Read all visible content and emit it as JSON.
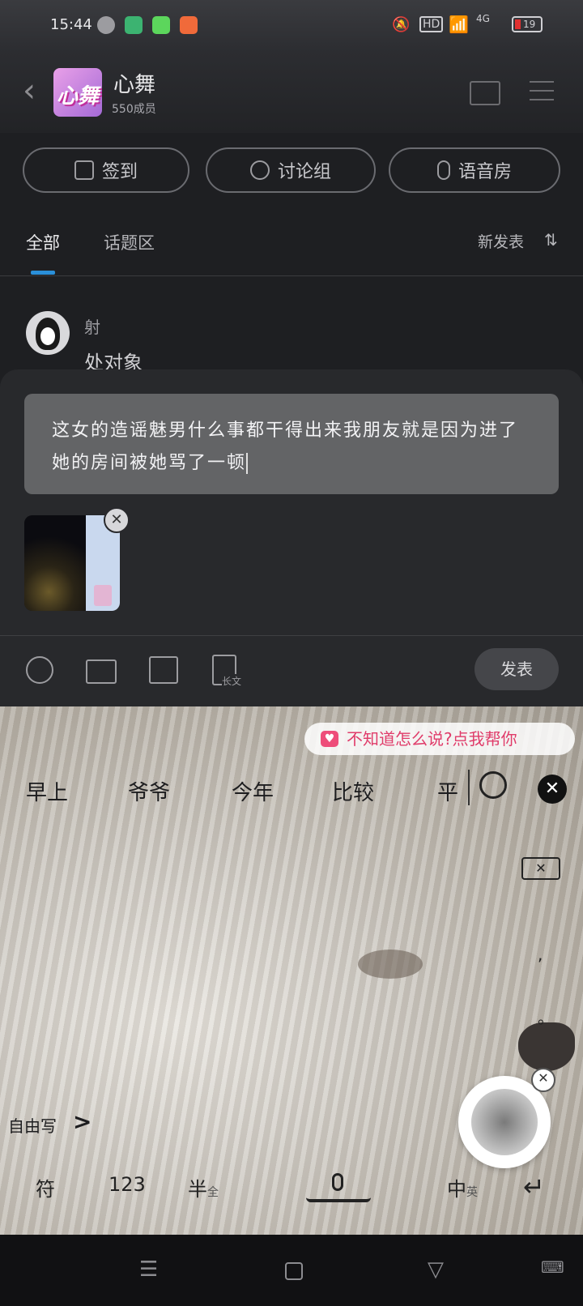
{
  "status_bar": {
    "time": "15:44",
    "hd_label": "HD",
    "network": "4G",
    "battery": "19"
  },
  "header": {
    "group_name": "心舞",
    "member_count": "550成员",
    "avatar_text": "心舞"
  },
  "actions": {
    "checkin": "签到",
    "discussion": "讨论组",
    "voice_room": "语音房"
  },
  "tabs": {
    "all": "全部",
    "topics": "话题区",
    "sort": "新发表"
  },
  "post": {
    "author": "射",
    "content": "处对象"
  },
  "compose": {
    "text": "这女的造谣魅男什么事都干得出来我朋友就是因为进了她的房间被她骂了一顿",
    "longtext_label": "长文",
    "publish": "发表"
  },
  "keyboard": {
    "suggest_bubble": "不知道怎么说?点我帮你",
    "candidates": [
      "早上",
      "爷爷",
      "今年",
      "比较",
      "平"
    ],
    "freewrite": "自由写",
    "comma": ",",
    "period": "。",
    "symbols": "符",
    "numbers": "123",
    "half": "半",
    "half_sub": "全",
    "lang": "中",
    "lang_sub": "英"
  },
  "colors": {
    "accent": "#2a8fd9",
    "background": "#1e1f22",
    "panel": "#28292c"
  }
}
